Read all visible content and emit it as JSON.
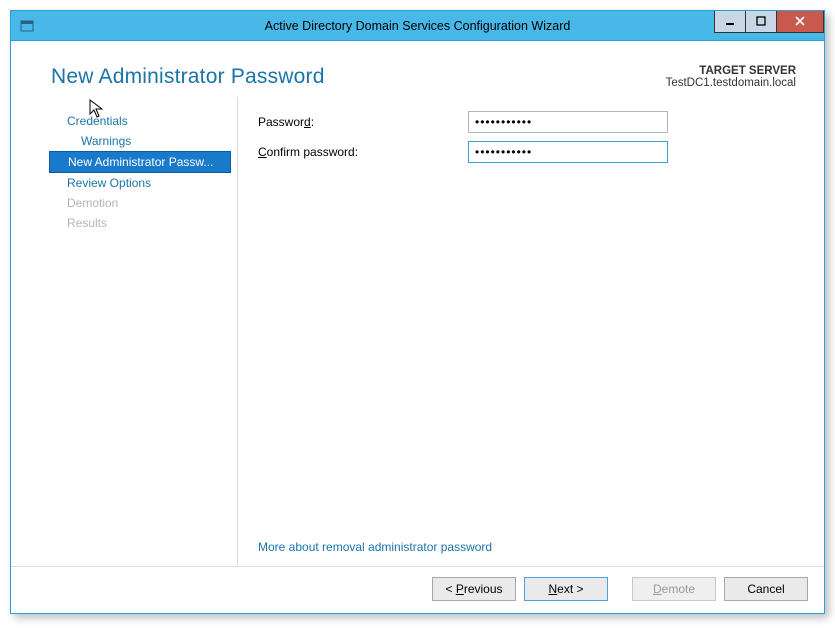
{
  "window": {
    "title": "Active Directory Domain Services Configuration Wizard"
  },
  "header": {
    "page_title": "New Administrator Password",
    "target_label": "TARGET SERVER",
    "target_server": "TestDC1.testdomain.local"
  },
  "sidebar": {
    "items": [
      {
        "label": "Credentials",
        "state": "normal"
      },
      {
        "label": "Warnings",
        "state": "sub"
      },
      {
        "label": "New Administrator Passw...",
        "state": "active"
      },
      {
        "label": "Review Options",
        "state": "normal"
      },
      {
        "label": "Demotion",
        "state": "disabled"
      },
      {
        "label": "Results",
        "state": "disabled"
      }
    ]
  },
  "form": {
    "password_label": "Password:",
    "confirm_label": "Confirm password:",
    "password_value": "•••••••••••",
    "confirm_value": "•••••••••••"
  },
  "help_link": "More about removal administrator password",
  "buttons": {
    "previous": "< Previous",
    "next": "Next >",
    "demote": "Demote",
    "cancel": "Cancel"
  }
}
